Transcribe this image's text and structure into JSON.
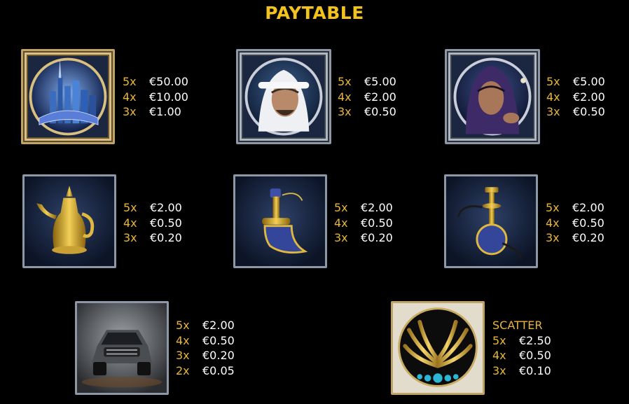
{
  "title": "PAYTABLE",
  "symbols": [
    {
      "name": "city",
      "pays": [
        {
          "count": "5x",
          "amount": "€50.00"
        },
        {
          "count": "4x",
          "amount": "€10.00"
        },
        {
          "count": "3x",
          "amount": "€1.00"
        }
      ]
    },
    {
      "name": "man",
      "pays": [
        {
          "count": "5x",
          "amount": "€5.00"
        },
        {
          "count": "4x",
          "amount": "€2.00"
        },
        {
          "count": "3x",
          "amount": "€0.50"
        }
      ]
    },
    {
      "name": "woman",
      "pays": [
        {
          "count": "5x",
          "amount": "€5.00"
        },
        {
          "count": "4x",
          "amount": "€2.00"
        },
        {
          "count": "3x",
          "amount": "€0.50"
        }
      ]
    },
    {
      "name": "coffee-pot",
      "pays": [
        {
          "count": "5x",
          "amount": "€2.00"
        },
        {
          "count": "4x",
          "amount": "€0.50"
        },
        {
          "count": "3x",
          "amount": "€0.20"
        }
      ]
    },
    {
      "name": "dagger",
      "pays": [
        {
          "count": "5x",
          "amount": "€2.00"
        },
        {
          "count": "4x",
          "amount": "€0.50"
        },
        {
          "count": "3x",
          "amount": "€0.20"
        }
      ]
    },
    {
      "name": "hookah",
      "pays": [
        {
          "count": "5x",
          "amount": "€2.00"
        },
        {
          "count": "4x",
          "amount": "€0.50"
        },
        {
          "count": "3x",
          "amount": "€0.20"
        }
      ]
    },
    {
      "name": "suv",
      "pays": [
        {
          "count": "5x",
          "amount": "€2.00"
        },
        {
          "count": "4x",
          "amount": "€0.50"
        },
        {
          "count": "3x",
          "amount": "€0.20"
        },
        {
          "count": "2x",
          "amount": "€0.05"
        }
      ]
    },
    {
      "name": "palm-scatter",
      "label": "SCATTER",
      "pays": [
        {
          "count": "5x",
          "amount": "€2.50"
        },
        {
          "count": "4x",
          "amount": "€0.50"
        },
        {
          "count": "3x",
          "amount": "€0.10"
        }
      ]
    }
  ],
  "colors": {
    "title": "#f4c21c",
    "count": "#e8b53a",
    "amount": "#ffffff",
    "background": "#000000"
  }
}
